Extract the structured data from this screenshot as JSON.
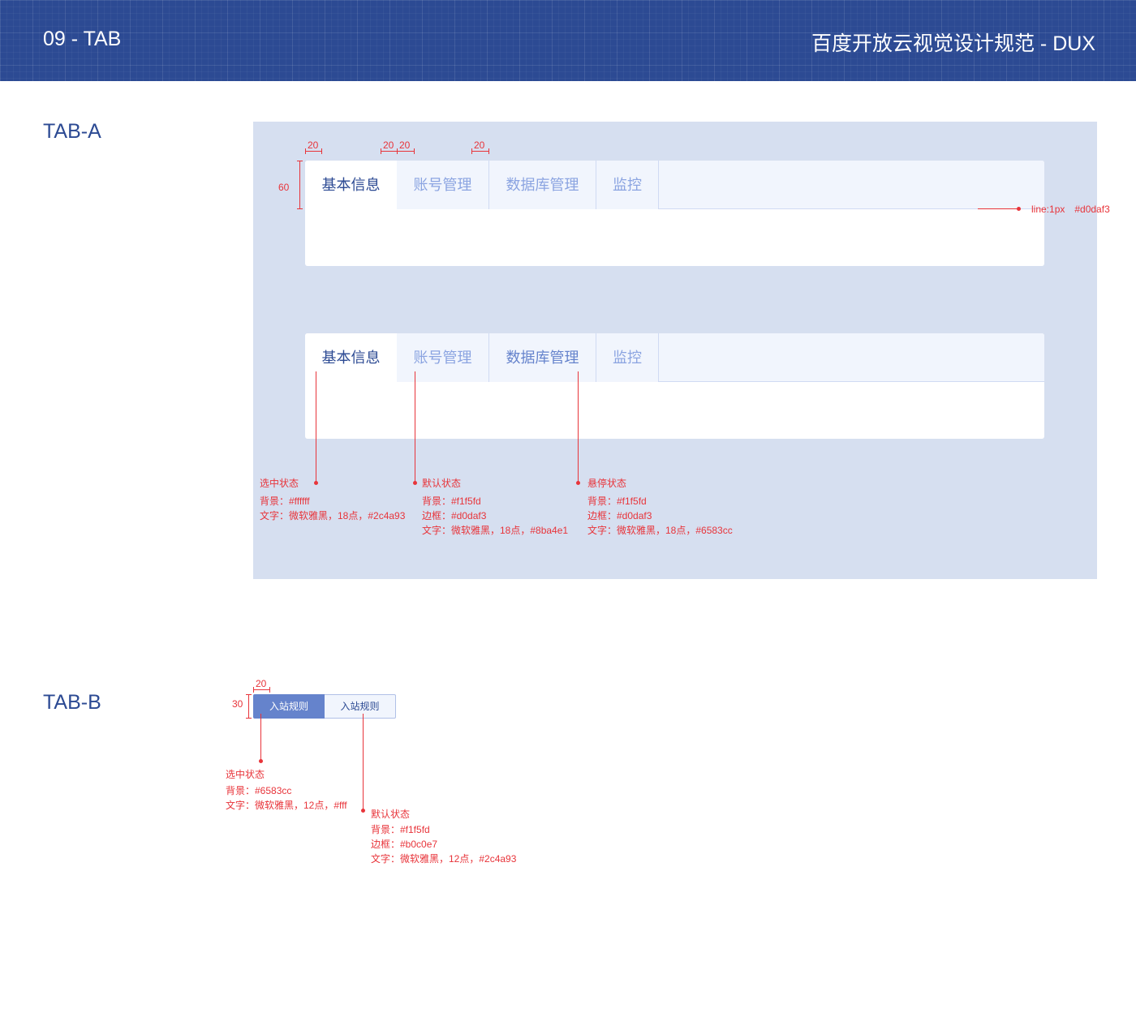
{
  "header": {
    "left_title": "09 - TAB",
    "right_title": "百度开放云视觉设计规范 - DUX"
  },
  "sections": {
    "tab_a": "TAB-A",
    "tab_b": "TAB-B"
  },
  "tab_a": {
    "tabs": [
      "基本信息",
      "账号管理",
      "数据库管理",
      "监控"
    ],
    "dims": {
      "padding": "20",
      "height": "60"
    },
    "line_note": "line:1px　#d0daf3",
    "notes": {
      "selected": {
        "title": "选中状态",
        "lines": [
          "背景：#ffffff",
          "文字：微软雅黑，18点，#2c4a93"
        ]
      },
      "default": {
        "title": "默认状态",
        "lines": [
          "背景：#f1f5fd",
          "边框：#d0daf3",
          "文字：微软雅黑，18点，#8ba4e1"
        ]
      },
      "hover": {
        "title": "悬停状态",
        "lines": [
          "背景：#f1f5fd",
          "边框：#d0daf3",
          "文字：微软雅黑，18点，#6583cc"
        ]
      }
    }
  },
  "tab_b": {
    "tabs": [
      "入站规则",
      "入站规则"
    ],
    "dims": {
      "padding": "20",
      "height": "30"
    },
    "notes": {
      "selected": {
        "title": "选中状态",
        "lines": [
          "背景：#6583cc",
          "文字：微软雅黑，12点，#fff"
        ]
      },
      "default": {
        "title": "默认状态",
        "lines": [
          "背景：#f1f5fd",
          "边框：#b0c0e7",
          "文字：微软雅黑，12点，#2c4a93"
        ]
      }
    }
  },
  "colors": {
    "brand": "#2c4a93",
    "panel_bg": "#d6dff0",
    "tab_bg": "#f1f5fd",
    "tab_border": "#d0daf3",
    "tab_text": "#8ba4e1",
    "tab_hover": "#6583cc",
    "annotation": "#e8343a",
    "tabb_active": "#6583cc",
    "tabb_border": "#b0c0e7"
  }
}
